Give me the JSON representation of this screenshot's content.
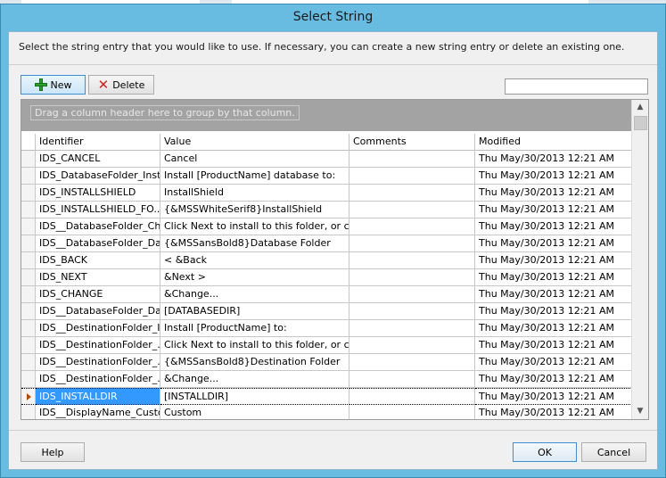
{
  "window": {
    "title": "Select String"
  },
  "instruction": "Select the string entry that you would like to use. If necessary, you can create a new string entry or delete an existing one.",
  "toolbar": {
    "new_label": "New",
    "delete_label": "Delete",
    "search_value": ""
  },
  "grid": {
    "group_hint": "Drag a column header here to group by that column.",
    "columns": [
      "Identifier",
      "Value",
      "Comments",
      "Modified"
    ],
    "rows": [
      {
        "id": "IDS_CANCEL",
        "value": "Cancel",
        "comments": "",
        "modified": "Thu May/30/2013 12:21 AM"
      },
      {
        "id": "IDS_DatabaseFolder_Inst...",
        "value": "Install [ProductName] database to:",
        "comments": "",
        "modified": "Thu May/30/2013 12:21 AM"
      },
      {
        "id": "IDS_INSTALLSHIELD",
        "value": "InstallShield",
        "comments": "",
        "modified": "Thu May/30/2013 12:21 AM"
      },
      {
        "id": "IDS_INSTALLSHIELD_FO...",
        "value": "{&MSSWhiteSerif8}InstallShield",
        "comments": "",
        "modified": "Thu May/30/2013 12:21 AM"
      },
      {
        "id": "IDS__DatabaseFolder_Ch...",
        "value": "Click Next to install to this folder, or click...",
        "comments": "",
        "modified": "Thu May/30/2013 12:21 AM"
      },
      {
        "id": "IDS__DatabaseFolder_Da...",
        "value": "{&MSSansBold8}Database Folder",
        "comments": "",
        "modified": "Thu May/30/2013 12:21 AM"
      },
      {
        "id": "IDS_BACK",
        "value": "< &Back",
        "comments": "",
        "modified": "Thu May/30/2013 12:21 AM"
      },
      {
        "id": "IDS_NEXT",
        "value": "&Next >",
        "comments": "",
        "modified": "Thu May/30/2013 12:21 AM"
      },
      {
        "id": "IDS_CHANGE",
        "value": "&Change...",
        "comments": "",
        "modified": "Thu May/30/2013 12:21 AM"
      },
      {
        "id": "IDS__DatabaseFolder_Da...",
        "value": "[DATABASEDIR]",
        "comments": "",
        "modified": "Thu May/30/2013 12:21 AM"
      },
      {
        "id": "IDS__DestinationFolder_I...",
        "value": "Install [ProductName] to:",
        "comments": "",
        "modified": "Thu May/30/2013 12:21 AM"
      },
      {
        "id": "IDS__DestinationFolder_...",
        "value": "Click Next to install to this folder, or click...",
        "comments": "",
        "modified": "Thu May/30/2013 12:21 AM"
      },
      {
        "id": "IDS__DestinationFolder_...",
        "value": "{&MSSansBold8}Destination Folder",
        "comments": "",
        "modified": "Thu May/30/2013 12:21 AM"
      },
      {
        "id": "IDS__DestinationFolder_...",
        "value": "&Change...",
        "comments": "",
        "modified": "Thu May/30/2013 12:21 AM"
      },
      {
        "id": "IDS_INSTALLDIR",
        "value": "[INSTALLDIR]",
        "comments": "",
        "modified": "Thu May/30/2013 12:21 AM",
        "selected": true
      },
      {
        "id": "IDS__DisplayName_Custom",
        "value": "Custom",
        "comments": "",
        "modified": "Thu May/30/2013 12:21 AM"
      }
    ]
  },
  "footer": {
    "help_label": "Help",
    "ok_label": "OK",
    "cancel_label": "Cancel"
  },
  "colors": {
    "accent": "#3399ff",
    "title_bar": "#68bce2"
  }
}
